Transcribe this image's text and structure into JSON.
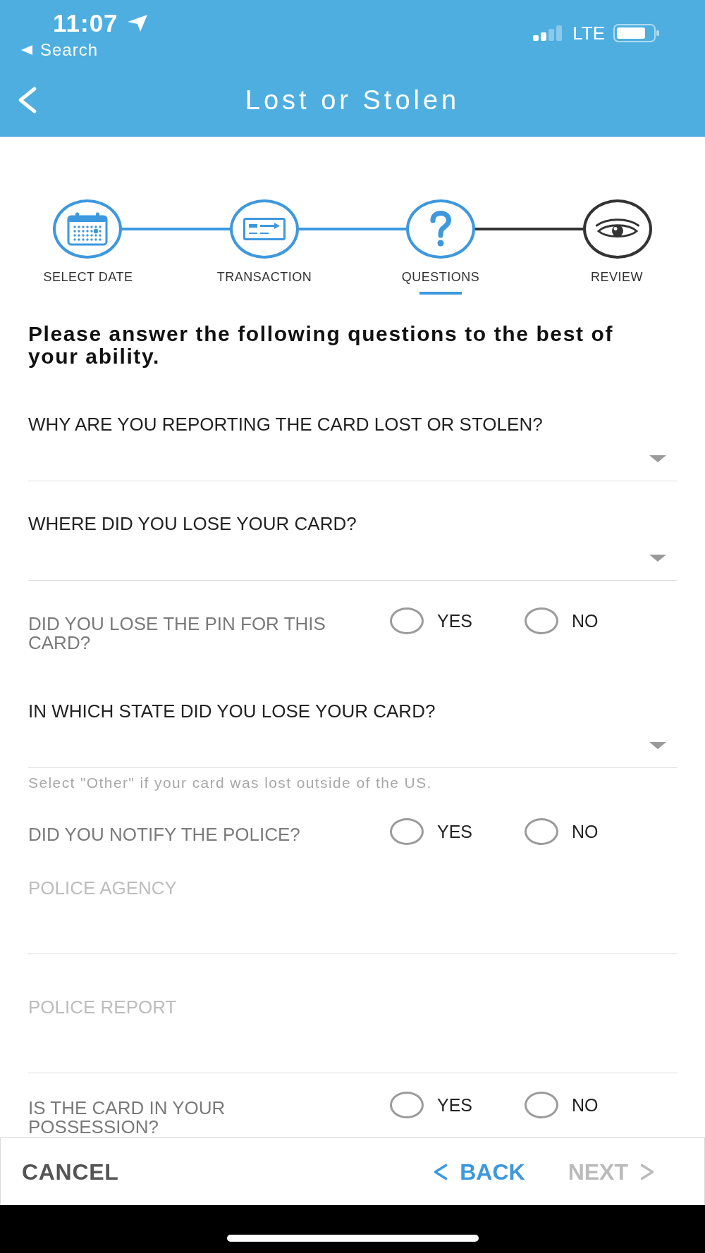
{
  "status_bar": {
    "time": "11:07",
    "back_link": "Search",
    "network": "LTE"
  },
  "nav_bar": {
    "title": "Lost or Stolen"
  },
  "steps": [
    {
      "label": "SELECT DATE",
      "reached": true,
      "selected": false
    },
    {
      "label": "TRANSACTION",
      "reached": true,
      "selected": false
    },
    {
      "label": "QUESTIONS",
      "reached": true,
      "selected": true
    },
    {
      "label": "REVIEW",
      "reached": false,
      "selected": false
    }
  ],
  "instructions": "Please answer the following questions to the best of your ability.",
  "fields": [
    {
      "kind": "select",
      "label": "WHY ARE YOU REPORTING THE CARD LOST OR STOLEN?"
    },
    {
      "kind": "select",
      "label": "WHERE DID YOU LOSE YOUR CARD?"
    },
    {
      "kind": "radio",
      "label": "DID YOU LOSE THE PIN FOR THIS CARD?",
      "options": [
        {
          "label": "YES",
          "selected": false
        },
        {
          "label": "NO",
          "selected": false
        }
      ]
    },
    {
      "kind": "select",
      "label": "IN WHICH STATE DID YOU LOSE YOUR CARD?",
      "help": "Select \"Other\" if your card was lost outside of the US."
    },
    {
      "kind": "radio",
      "label": "DID YOU NOTIFY THE POLICE?",
      "options": [
        {
          "label": "YES",
          "selected": false
        },
        {
          "label": "NO",
          "selected": false
        }
      ]
    },
    {
      "kind": "text",
      "placeholder": "POLICE AGENCY"
    },
    {
      "kind": "text",
      "placeholder": "POLICE REPORT"
    },
    {
      "kind": "radio",
      "label": "IS THE CARD IN YOUR POSSESSION?",
      "options": [
        {
          "label": "YES",
          "selected": false
        },
        {
          "label": "NO",
          "selected": false
        }
      ]
    }
  ],
  "footer": {
    "cancel": "CANCEL",
    "back": {
      "label": "BACK",
      "disabled": false
    },
    "next": {
      "label": "NEXT",
      "disabled": true
    }
  }
}
